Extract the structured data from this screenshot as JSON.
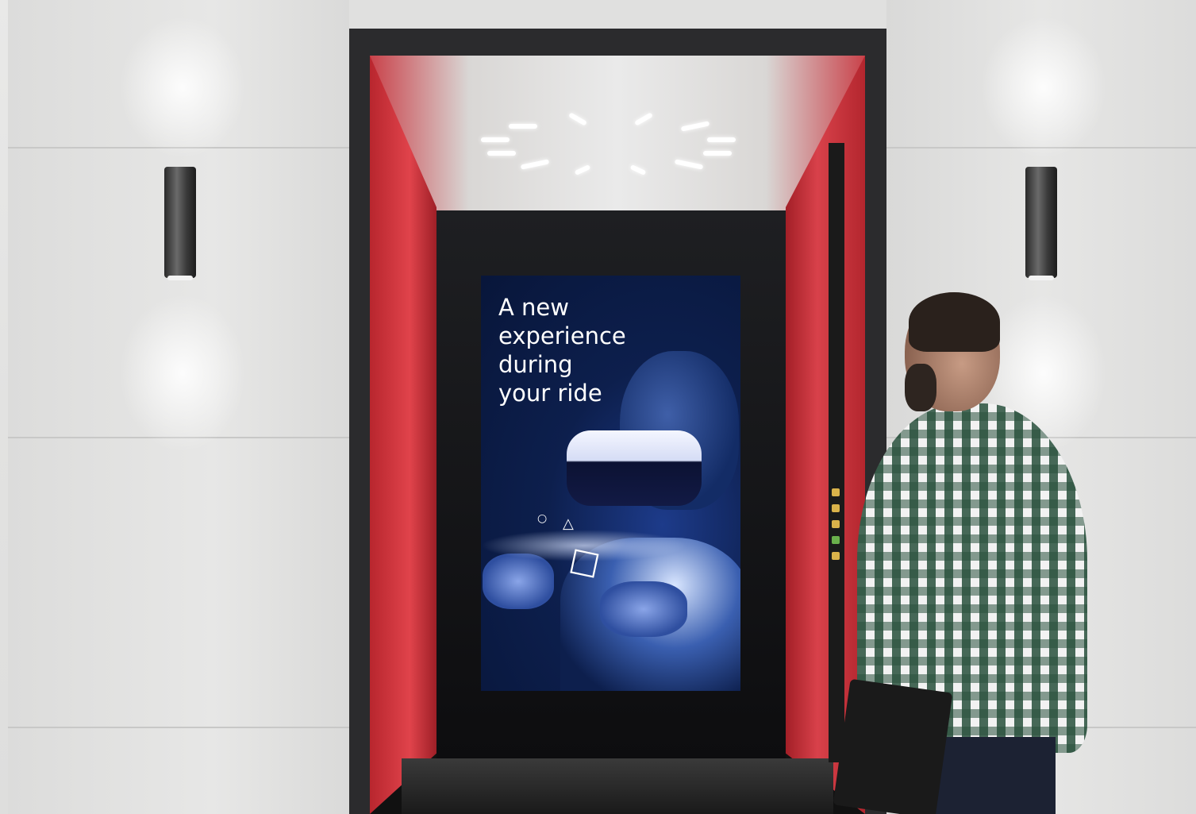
{
  "scene": {
    "description_alt": "Elevator interior with digital poster",
    "accent_colors": {
      "elevator_red": "#d9404a",
      "poster_navy": "#0d1f4d",
      "wall_gray": "#e4e4e3"
    }
  },
  "poster": {
    "headline_lines": [
      "A new",
      "experience",
      "during",
      "your ride"
    ],
    "shapes": {
      "circle_icon": "○",
      "triangle_icon": "△",
      "square_icon": "□"
    }
  }
}
